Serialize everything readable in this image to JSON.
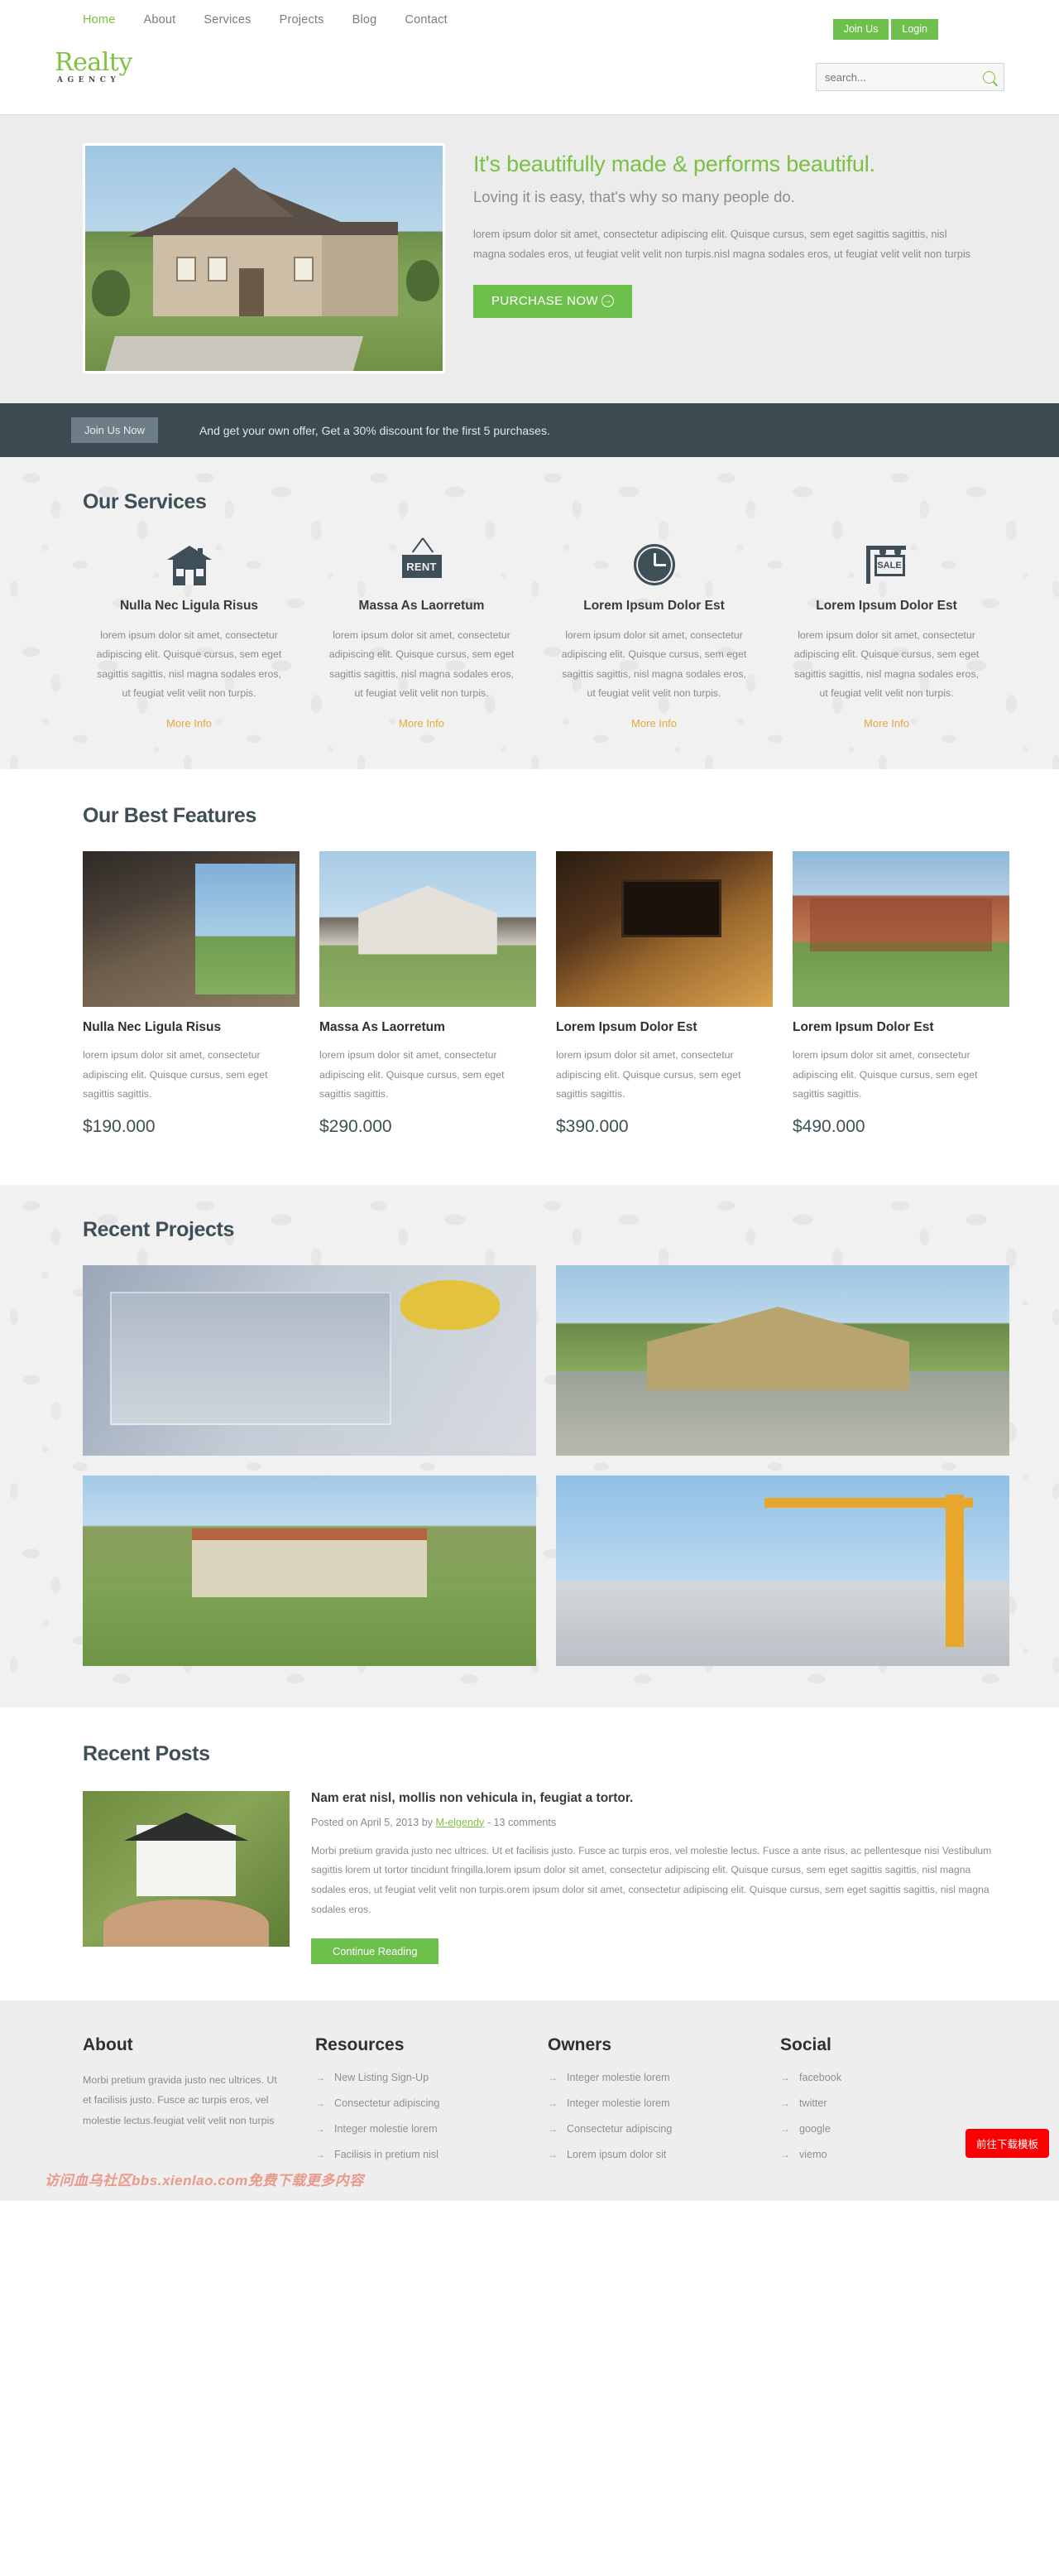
{
  "nav": {
    "items": [
      {
        "label": "Home",
        "active": true
      },
      {
        "label": "About",
        "active": false
      },
      {
        "label": "Services",
        "active": false
      },
      {
        "label": "Projects",
        "active": false
      },
      {
        "label": "Blog",
        "active": false
      },
      {
        "label": "Contact",
        "active": false
      }
    ],
    "join_label": "Join Us",
    "login_label": "Login"
  },
  "brand": {
    "name": "Realty",
    "tagline": "AGENCY",
    "accent_color": "#7ec242"
  },
  "search": {
    "placeholder": "search...",
    "value": "",
    "icon": "search-icon"
  },
  "hero": {
    "heading": "It's beautifully made & performs beautiful.",
    "subheading": "Loving it is easy, that's why so many people do.",
    "body": "lorem ipsum dolor sit amet, consectetur adipiscing elit. Quisque cursus, sem eget sagittis sagittis, nisl magna sodales eros, ut feugiat velit velit non turpis.nisl magna sodales eros, ut feugiat velit velit non turpis",
    "cta_label": "PURCHASE NOW",
    "cta_icon": "arrow-right-circle-icon",
    "image_alt": "suburban-house-photo"
  },
  "join_strip": {
    "button_label": "Join Us Now",
    "text": "And get your own offer, Get a 30% discount for the first 5 purchases.",
    "background_color": "#3c4b52"
  },
  "services": {
    "title": "Our Services",
    "more_label": "More Info",
    "more_color": "#e2a93d",
    "items": [
      {
        "icon": "house-icon",
        "title": "Nulla Nec Ligula Risus",
        "text": "lorem ipsum dolor sit amet, consectetur adipiscing elit. Quisque cursus, sem eget sagittis sagittis, nisl magna sodales eros, ut feugiat velit velit non turpis."
      },
      {
        "icon": "rent-sign-icon",
        "icon_text": "RENT",
        "title": "Massa As Laorretum",
        "text": "lorem ipsum dolor sit amet, consectetur adipiscing elit. Quisque cursus, sem eget sagittis sagittis, nisl magna sodales eros, ut feugiat velit velit non turpis."
      },
      {
        "icon": "clock-icon",
        "title": "Lorem Ipsum Dolor Est",
        "text": "lorem ipsum dolor sit amet, consectetur adipiscing elit. Quisque cursus, sem eget sagittis sagittis, nisl magna sodales eros, ut feugiat velit velit non turpis."
      },
      {
        "icon": "sale-sign-icon",
        "icon_text": "SALE",
        "title": "Lorem Ipsum Dolor Est",
        "text": "lorem ipsum dolor sit amet, consectetur adipiscing elit. Quisque cursus, sem eget sagittis sagittis, nisl magna sodales eros, ut feugiat velit velit non turpis."
      }
    ]
  },
  "features": {
    "title": "Our Best Features",
    "items": [
      {
        "image_alt": "living-room-photo",
        "title": "Nulla Nec Ligula Risus",
        "text": "lorem ipsum dolor sit amet, consectetur adipiscing elit. Quisque cursus, sem eget sagittis sagittis.",
        "price": "$190.000"
      },
      {
        "image_alt": "white-houses-photo",
        "title": "Massa As Laorretum",
        "text": "lorem ipsum dolor sit amet, consectetur adipiscing elit. Quisque cursus, sem eget sagittis sagittis.",
        "price": "$290.000"
      },
      {
        "image_alt": "media-room-photo",
        "title": "Lorem Ipsum Dolor Est",
        "text": "lorem ipsum dolor sit amet, consectetur adipiscing elit. Quisque cursus, sem eget sagittis sagittis.",
        "price": "$390.000"
      },
      {
        "image_alt": "villa-photo",
        "title": "Lorem Ipsum Dolor Est",
        "text": "lorem ipsum dolor sit amet, consectetur adipiscing elit. Quisque cursus, sem eget sagittis sagittis.",
        "price": "$490.000"
      }
    ]
  },
  "projects": {
    "title": "Recent Projects",
    "items": [
      {
        "image_alt": "blueprint-hands-photo"
      },
      {
        "image_alt": "suburban-home-driveway-photo"
      },
      {
        "image_alt": "palm-tree-villas-photo"
      },
      {
        "image_alt": "construction-crane-photo"
      }
    ]
  },
  "posts": {
    "title": "Recent Posts",
    "item": {
      "image_alt": "house-in-hand-photo",
      "title": "Nam erat nisl, mollis non vehicula in, feugiat a tortor.",
      "meta_prefix": "Posted on April 5, 2013 by ",
      "author": "M-elgendy",
      "meta_suffix": " - 13 comments",
      "body": "Morbi pretium gravida justo nec ultrices. Ut et facilisis justo. Fusce ac turpis eros, vel molestie lectus. Fusce a ante risus, ac pellentesque nisi Vestibulum sagittis lorem ut tortor tincidunt fringilla.lorem ipsum dolor sit amet, consectetur adipiscing elit. Quisque cursus, sem eget sagittis sagittis, nisl magna sodales eros, ut feugiat velit velit non turpis.orem ipsum dolor sit amet, consectetur adipiscing elit. Quisque cursus, sem eget sagittis sagittis, nisl magna sodales eros.",
      "cta_label": "Continue Reading"
    }
  },
  "footer": {
    "about": {
      "title": "About",
      "text": "Morbi pretium gravida justo nec ultrices. Ut et facilisis justo. Fusce ac turpis eros, vel molestie lectus.feugiat velit velit non turpis"
    },
    "resources": {
      "title": "Resources",
      "links": [
        "New Listing Sign-Up",
        "Consectetur adipiscing",
        "Integer molestie lorem",
        "Facilisis in pretium nisl"
      ]
    },
    "owners": {
      "title": "Owners",
      "links": [
        "Integer molestie lorem",
        "Integer molestie lorem",
        "Consectetur adipiscing",
        "Lorem ipsum dolor sit"
      ]
    },
    "social": {
      "title": "Social",
      "links": [
        "facebook",
        "twitter",
        "google",
        "viemo"
      ]
    },
    "arrow_glyph": "→"
  },
  "overlay": {
    "watermark": "访问血乌社区bbs.xienlao.com免费下载更多内容",
    "download_button": "前往下载模板",
    "download_button_color": "#fb0000"
  }
}
